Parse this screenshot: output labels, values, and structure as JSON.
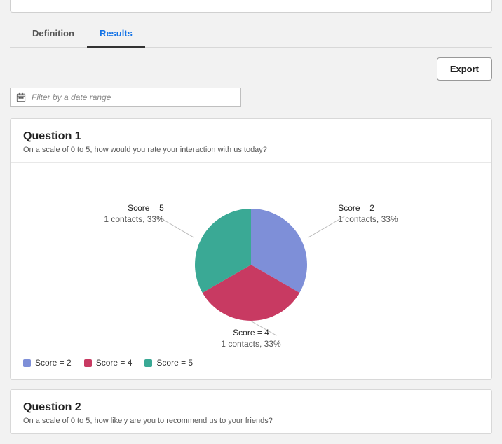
{
  "tabs": {
    "definition_label": "Definition",
    "results_label": "Results"
  },
  "toolbar": {
    "export_label": "Export"
  },
  "filter": {
    "placeholder": "Filter by a date range"
  },
  "question1": {
    "title": "Question 1",
    "subtitle": "On a scale of 0 to 5, how would you rate your interaction with us today?",
    "slices": {
      "score2_line1": "Score = 2",
      "score2_line2": "1 contacts, 33%",
      "score4_line1": "Score = 4",
      "score4_line2": "1 contacts, 33%",
      "score5_line1": "Score = 5",
      "score5_line2": "1 contacts, 33%"
    },
    "legend": {
      "score2": "Score = 2",
      "score4": "Score = 4",
      "score5": "Score = 5"
    }
  },
  "question2": {
    "title": "Question 2",
    "subtitle": "On a scale of 0 to 5, how likely are you to recommend us to your friends?"
  },
  "colors": {
    "score2": "#7e8fd8",
    "score4": "#c83a62",
    "score5": "#3aa995"
  },
  "chart_data": [
    {
      "type": "pie",
      "title": "Question 1",
      "subtitle": "On a scale of 0 to 5, how would you rate your interaction with us today?",
      "series": [
        {
          "name": "Score = 2",
          "value": 1,
          "percent": 33,
          "color": "#7e8fd8"
        },
        {
          "name": "Score = 4",
          "value": 1,
          "percent": 33,
          "color": "#c83a62"
        },
        {
          "name": "Score = 5",
          "value": 1,
          "percent": 33,
          "color": "#3aa995"
        }
      ],
      "value_label": "contacts"
    }
  ]
}
